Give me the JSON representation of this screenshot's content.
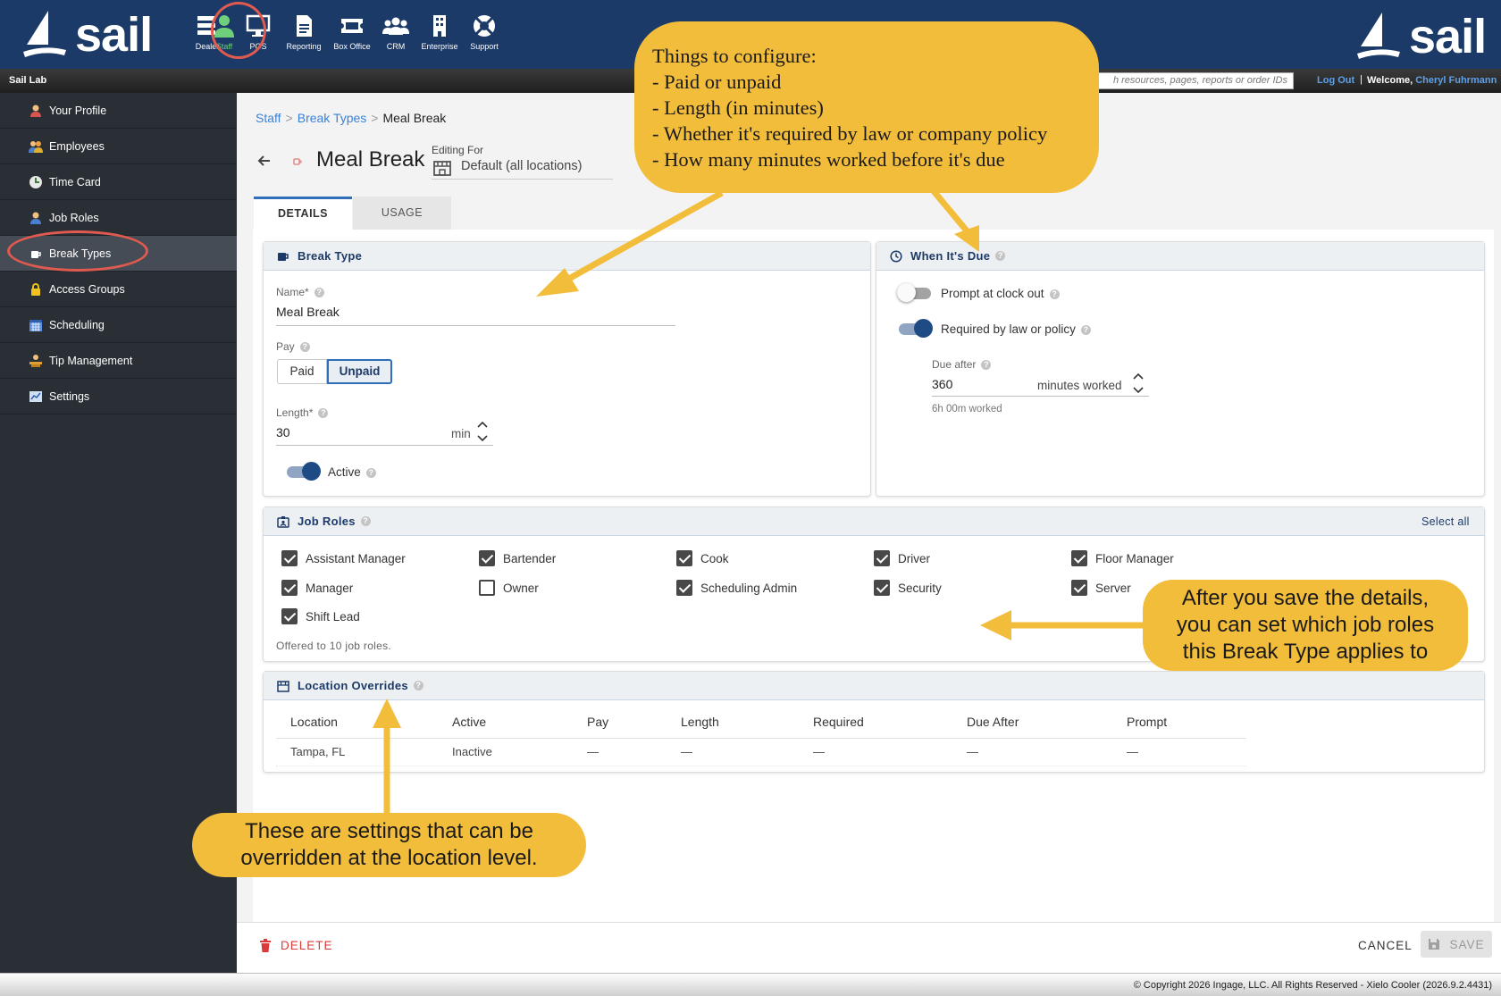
{
  "brand": {
    "logo_text": "sail"
  },
  "top_nav": {
    "items": [
      {
        "label": "Dealer",
        "icon": "dealer-icon"
      },
      {
        "label": "Staff",
        "icon": "person-icon",
        "active": true
      },
      {
        "label": "POS",
        "icon": "monitor-icon"
      },
      {
        "label": "Reporting",
        "icon": "document-icon"
      },
      {
        "label": "Box Office",
        "icon": "ticket-icon"
      },
      {
        "label": "CRM",
        "icon": "people-icon"
      },
      {
        "label": "Enterprise",
        "icon": "building-icon"
      },
      {
        "label": "Support",
        "icon": "lifebuoy-icon"
      }
    ]
  },
  "subbar": {
    "company": "Sail Lab",
    "search_placeholder": "h resources, pages, reports or order IDs",
    "logout": "Log Out",
    "separator": "|",
    "welcome": "Welcome,",
    "user_name": "Cheryl Fuhrmann"
  },
  "sidebar": {
    "items": [
      {
        "label": "Your Profile",
        "icon": "profile-icon"
      },
      {
        "label": "Employees",
        "icon": "employees-icon"
      },
      {
        "label": "Time Card",
        "icon": "clock-icon"
      },
      {
        "label": "Job Roles",
        "icon": "job-role-icon"
      },
      {
        "label": "Break Types",
        "icon": "coffee-cup-icon",
        "active": true
      },
      {
        "label": "Access Groups",
        "icon": "lock-icon"
      },
      {
        "label": "Scheduling",
        "icon": "calendar-icon"
      },
      {
        "label": "Tip Management",
        "icon": "tip-icon"
      },
      {
        "label": "Settings",
        "icon": "settings-icon"
      }
    ]
  },
  "breadcrumb": {
    "root": "Staff",
    "sep": ">",
    "parent": "Break Types",
    "current": "Meal Break"
  },
  "header": {
    "title": "Meal Break",
    "editing_for_label": "Editing For",
    "editing_for_value": "Default (all locations)"
  },
  "tabs": {
    "details": "DETAILS",
    "usage": "USAGE"
  },
  "break_type": {
    "section_title": "Break Type",
    "name_label": "Name*",
    "name_value": "Meal Break",
    "pay_label": "Pay",
    "pay_options": [
      "Paid",
      "Unpaid"
    ],
    "pay_selected": "Unpaid",
    "length_label": "Length*",
    "length_value": "30",
    "length_unit": "min",
    "active_label": "Active",
    "active_on": true
  },
  "due": {
    "section_title": "When It's Due",
    "prompt_label": "Prompt at clock out",
    "prompt_on": false,
    "required_label": "Required by law or policy",
    "required_on": true,
    "due_after_label": "Due after",
    "due_after_value": "360",
    "due_after_unit": "minutes worked",
    "due_after_hint": "6h 00m worked"
  },
  "job_roles": {
    "section_title": "Job Roles",
    "select_all": "Select all",
    "roles": [
      {
        "label": "Assistant Manager",
        "checked": true
      },
      {
        "label": "Bartender",
        "checked": true
      },
      {
        "label": "Cook",
        "checked": true
      },
      {
        "label": "Driver",
        "checked": true
      },
      {
        "label": "Floor Manager",
        "checked": true
      },
      {
        "label": "Manager",
        "checked": true
      },
      {
        "label": "Owner",
        "checked": false
      },
      {
        "label": "Scheduling Admin",
        "checked": true
      },
      {
        "label": "Security",
        "checked": true
      },
      {
        "label": "Server",
        "checked": true
      },
      {
        "label": "Shift Lead",
        "checked": true
      }
    ],
    "offered_text": "Offered to 10 job roles."
  },
  "location_overrides": {
    "section_title": "Location Overrides",
    "columns": [
      "Location",
      "Active",
      "Pay",
      "Length",
      "Required",
      "Due After",
      "Prompt"
    ],
    "rows": [
      [
        "Tampa, FL",
        "Inactive",
        "—",
        "—",
        "—",
        "—",
        "—"
      ]
    ]
  },
  "footer": {
    "delete": "DELETE",
    "cancel": "CANCEL",
    "save": "SAVE"
  },
  "copyright": "© Copyright 2026 Ingage, LLC. All Rights Reserved - Xielo Cooler (2026.9.2.4431)",
  "callouts": {
    "config_lines": [
      "Things to configure:",
      "- Paid or unpaid",
      "- Length (in minutes)",
      "- Whether it's required by law or company policy",
      "- How many minutes worked before it's due"
    ],
    "roles_lines": [
      "After you save the details,",
      "you can set which job roles",
      "this Break Type applies to"
    ],
    "override_lines": [
      "These are settings that can be",
      "overridden at the location level."
    ]
  },
  "colors": {
    "nav_bg": "#1c3a67",
    "accent": "#2e6fb7",
    "callout": "#f3bd3c",
    "highlight_ring": "#e05a4f",
    "delete": "#d93a3a"
  }
}
